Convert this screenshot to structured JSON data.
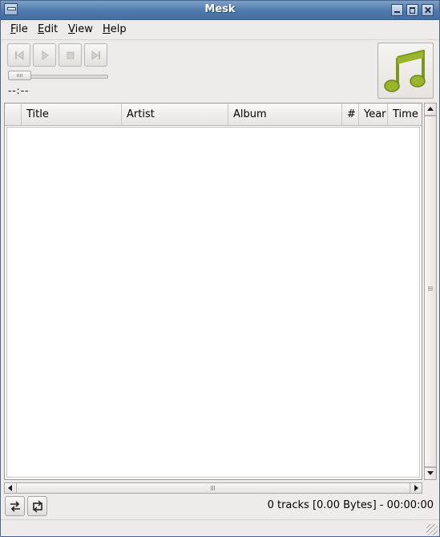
{
  "window": {
    "title": "Mesk"
  },
  "menubar": {
    "items": [
      {
        "mnemonic": "F",
        "rest": "ile"
      },
      {
        "mnemonic": "E",
        "rest": "dit"
      },
      {
        "mnemonic": "V",
        "rest": "iew"
      },
      {
        "mnemonic": "H",
        "rest": "elp"
      }
    ]
  },
  "player": {
    "buttons": [
      "previous-icon",
      "play-icon",
      "stop-icon",
      "next-icon"
    ],
    "time": "--:--",
    "seek_position": 0
  },
  "cover": {
    "icon": "music-note-icon",
    "color": "#9bb52a"
  },
  "tracklist": {
    "columns": [
      "",
      "Title",
      "Artist",
      "Album",
      "#",
      "Year",
      "Time"
    ],
    "rows": []
  },
  "bottombar": {
    "buttons": [
      "shuffle-icon",
      "repeat-icon"
    ],
    "status": "0 tracks [0.00 Bytes] - 00:00:00"
  }
}
